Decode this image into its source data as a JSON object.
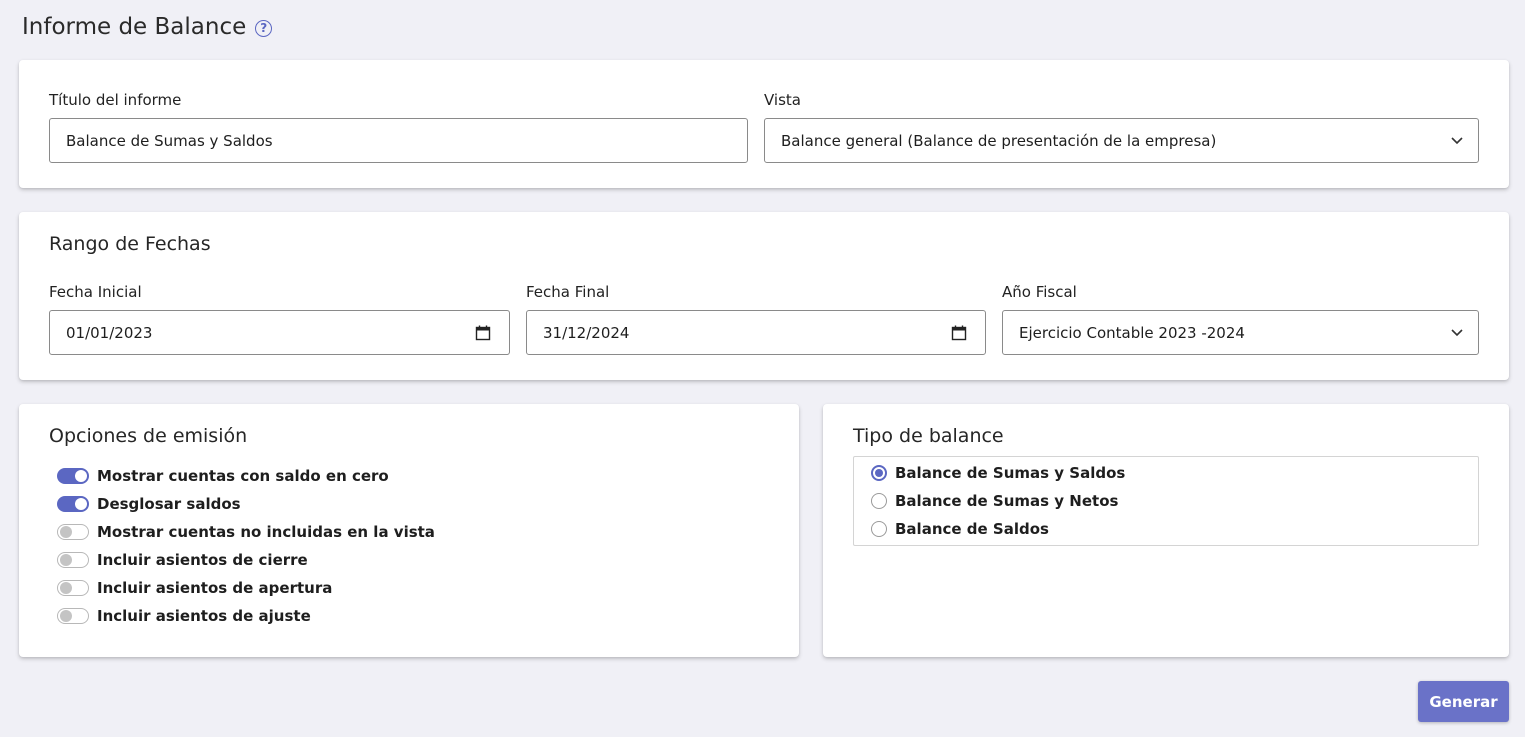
{
  "header": {
    "title": "Informe de Balance",
    "help_icon": "?"
  },
  "report": {
    "title_label": "Título del informe",
    "title_value": "Balance de Sumas y Saldos",
    "view_label": "Vista",
    "view_value": "Balance general (Balance de presentación de la empresa)"
  },
  "date_range": {
    "section_title": "Rango de Fechas",
    "start_label": "Fecha Inicial",
    "start_value": "01/01/2023",
    "end_label": "Fecha Final",
    "end_value": "31/12/2024",
    "fiscal_label": "Año Fiscal",
    "fiscal_value": "Ejercicio Contable 2023 -2024"
  },
  "emission_options": {
    "section_title": "Opciones de emisión",
    "items": [
      {
        "label": "Mostrar cuentas con saldo en cero",
        "checked": true
      },
      {
        "label": "Desglosar saldos",
        "checked": true
      },
      {
        "label": "Mostrar cuentas no incluidas en la vista",
        "checked": false
      },
      {
        "label": "Incluir asientos de cierre",
        "checked": false
      },
      {
        "label": "Incluir asientos de apertura",
        "checked": false
      },
      {
        "label": "Incluir asientos de ajuste",
        "checked": false
      }
    ]
  },
  "balance_type": {
    "section_title": "Tipo de balance",
    "options": [
      {
        "label": "Balance de Sumas y Saldos",
        "selected": true
      },
      {
        "label": "Balance de Sumas y Netos",
        "selected": false
      },
      {
        "label": "Balance de Saldos",
        "selected": false
      }
    ]
  },
  "actions": {
    "generate_label": "Generar"
  },
  "colors": {
    "accent": "#5b67c2",
    "button": "#6a72c8",
    "background": "#f0f0f6"
  }
}
